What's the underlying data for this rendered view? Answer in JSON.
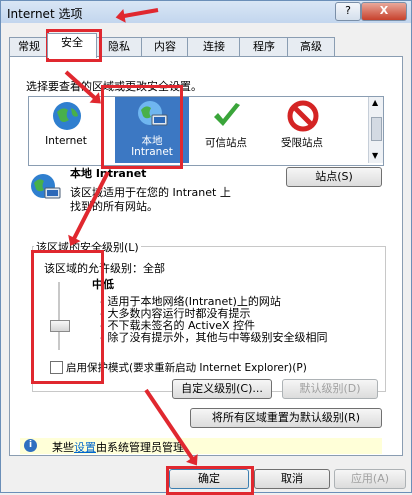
{
  "window": {
    "title": "Internet 选项",
    "help": "?",
    "close": "X"
  },
  "tabs": [
    "常规",
    "安全",
    "隐私",
    "内容",
    "连接",
    "程序",
    "高级"
  ],
  "zone_prompt": "选择要查看的区域或更改安全设置。",
  "zones": [
    {
      "label": "Internet",
      "icon": "globe-icon"
    },
    {
      "label_line1": "本地",
      "label_line2": "Intranet",
      "icon": "intranet-globe-icon"
    },
    {
      "label": "可信站点",
      "icon": "checkmark-icon"
    },
    {
      "label": "受限站点",
      "icon": "no-entry-icon"
    }
  ],
  "zone_info": {
    "title": "本地 Intranet",
    "desc1": "该区域适用于在您的 Intranet 上",
    "desc2": "找到的所有网站。",
    "sites_button": "站点(S)"
  },
  "security_level": {
    "group_label": "该区域的安全级别(L)",
    "allowed": "该区域的允许级别：全部",
    "level": "中低",
    "bullets": [
      "- 适用于本地网络(Intranet)上的网站",
      "- 大多数内容运行时都没有提示",
      "- 不下载未签名的 ActiveX 控件",
      "- 除了没有提示外，其他与中等级别安全级相同"
    ],
    "protected_mode": "启用保护模式(要求重新启动 Internet Explorer)(P)",
    "protected_mode_checked": false,
    "custom_button": "自定义级别(C)...",
    "default_button": "默认级别(D)"
  },
  "reset_all_button": "将所有区域重置为默认级别(R)",
  "info_bar": {
    "prefix": "某些",
    "link": "设置",
    "suffix": "由系统管理员管理。"
  },
  "footer": {
    "ok": "确定",
    "cancel": "取消",
    "apply": "应用(A)"
  },
  "colors": {
    "highlight": "#e0282f",
    "selection": "#3c78c3"
  }
}
